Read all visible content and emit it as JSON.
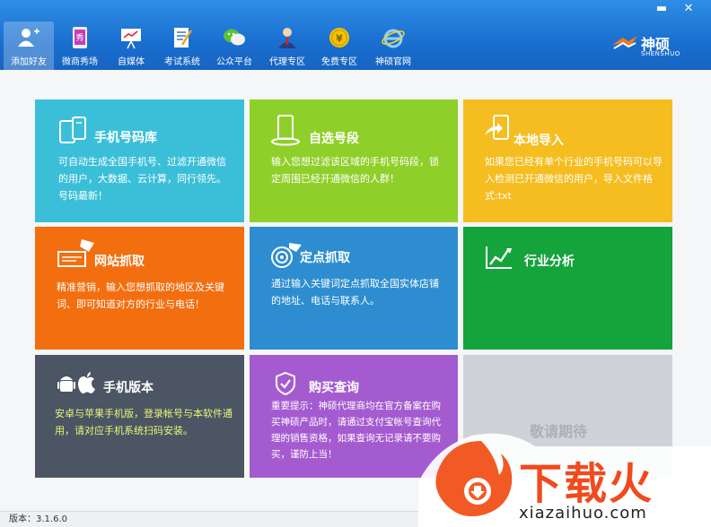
{
  "window": {
    "minimize": "▬",
    "close": "✕"
  },
  "toolbar": {
    "items": [
      {
        "label": "添加好友"
      },
      {
        "label": "微商秀场"
      },
      {
        "label": "自媒体"
      },
      {
        "label": "考试系统"
      },
      {
        "label": "公众平台"
      },
      {
        "label": "代理专区"
      },
      {
        "label": "免费专区"
      },
      {
        "label": "神硕官网"
      }
    ],
    "logo_name": "神硕",
    "logo_sub": "SHENSHUO"
  },
  "tiles": {
    "phone_db": {
      "title": "手机号码库",
      "desc": "可自动生成全国手机号、过滤开通微信的用户，大数据、云计算，同行领先。号码最新！",
      "color": "#3bbfd8"
    },
    "custom_segment": {
      "title": "自选号段",
      "desc": "输入您想过滤该区域的手机号码段，锁定周围已经开通微信的人群！",
      "color": "#8fcf2a"
    },
    "local_import": {
      "title": "本地导入",
      "desc": "如果您已经有单个行业的手机号码可以导入检测已开通微信的用户，导入文件格式:txt",
      "color": "#f5bd1f"
    },
    "web_grab": {
      "title": "网站抓取",
      "desc": "精准营销，输入您想抓取的地区及关键词、即可知道对方的行业与电话！",
      "color": "#f36e0f"
    },
    "point_grab": {
      "title": "定点抓取",
      "desc": "通过输入关键词定点抓取全国实体店铺的地址、电话与联系人。",
      "color": "#2d8dd0"
    },
    "industry": {
      "title": "行业分析",
      "color": "#15a33c"
    },
    "mobile": {
      "title": "手机版本",
      "desc": "安卓与苹果手机版，登录帐号与本软件通用，请对应手机系统扫码安装。",
      "color": "#4b5563"
    },
    "purchase": {
      "title": "购买查询",
      "desc": "重要提示：神硕代理商均在官方备案在购买神硕产品时，请通过支付宝帐号查询代理的销售资格，如果查询无记录请不要购买，谨防上当！",
      "color": "#a45bd0"
    },
    "coming": {
      "title": "敬请期待",
      "color": "#cfd3d8"
    }
  },
  "status": {
    "version": "版本：3.1.6.0"
  },
  "watermark": {
    "text": "下载火",
    "url": "xiazaihuo.com"
  }
}
